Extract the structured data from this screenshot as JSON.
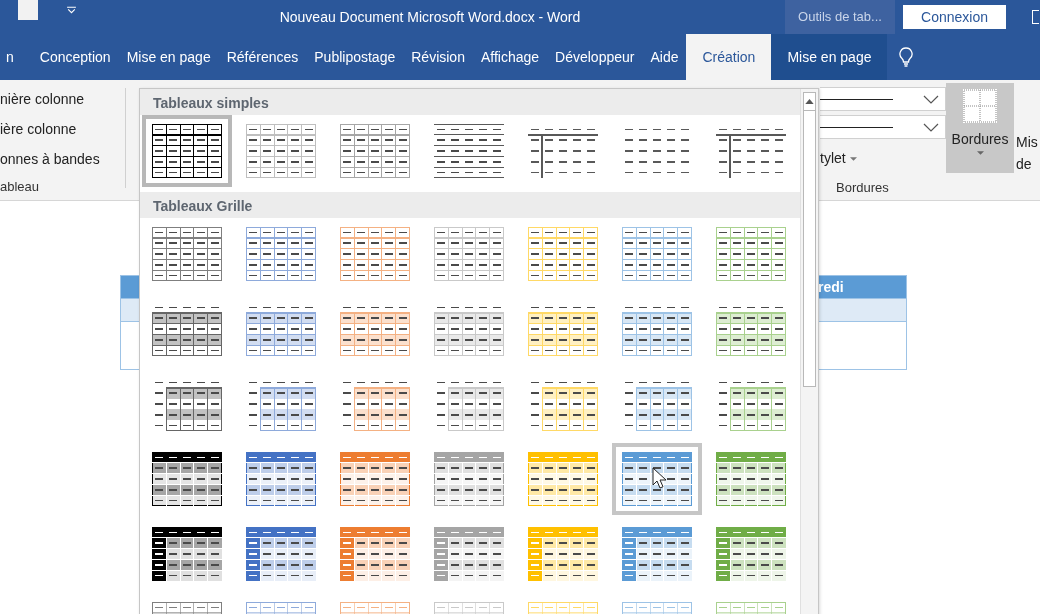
{
  "window": {
    "title": "Nouveau Document Microsoft Word.docx - Word",
    "context_label": "Outils de tab...",
    "signin": "Connexion"
  },
  "tabs": [
    {
      "label": "n",
      "selected": false,
      "kind": "standard"
    },
    {
      "label": "Conception",
      "selected": false,
      "kind": "standard"
    },
    {
      "label": "Mise en page",
      "selected": false,
      "kind": "standard"
    },
    {
      "label": "Références",
      "selected": false,
      "kind": "standard"
    },
    {
      "label": "Publipostage",
      "selected": false,
      "kind": "standard"
    },
    {
      "label": "Révision",
      "selected": false,
      "kind": "standard"
    },
    {
      "label": "Affichage",
      "selected": false,
      "kind": "standard"
    },
    {
      "label": "Développeur",
      "selected": false,
      "kind": "standard"
    },
    {
      "label": "Aide",
      "selected": false,
      "kind": "standard"
    },
    {
      "label": "Création",
      "selected": true,
      "kind": "contextual"
    },
    {
      "label": "Mise en page",
      "selected": false,
      "kind": "contextual"
    }
  ],
  "ribbon": {
    "options": [
      "nière colonne",
      "ière colonne",
      "onnes à bandes"
    ],
    "options_group": "ableau",
    "pen_style": "tylet",
    "borders_group": "Bordures",
    "borders_button": "Bordures",
    "next_button": [
      "Mis",
      "de"
    ]
  },
  "document": {
    "table_header": "redi"
  },
  "gallery": {
    "sections": [
      {
        "title": "Tableaux simples",
        "rows": [
          [
            {
              "kind": "grid",
              "color": "#000000",
              "selected": true,
              "hovered": false
            },
            {
              "kind": "grid",
              "color": "#bfbfbf",
              "selected": false,
              "hovered": false
            },
            {
              "kind": "grid",
              "color": "#a6a6a6",
              "selected": false,
              "hovered": false
            },
            {
              "kind": "lines",
              "color": "#595959",
              "selected": false,
              "hovered": false
            },
            {
              "kind": "first-col",
              "color": "#595959",
              "selected": false,
              "hovered": false
            },
            {
              "kind": "plain",
              "color": "#595959",
              "selected": false,
              "hovered": false
            },
            {
              "kind": "first-col",
              "color": "#595959",
              "selected": false,
              "hovered": false
            }
          ]
        ]
      },
      {
        "title": "Tableaux Grille",
        "rows": [
          [
            {
              "kind": "grid",
              "color": "#7f7f7f",
              "selected": false,
              "hovered": false
            },
            {
              "kind": "grid",
              "color": "#8eaadb",
              "selected": false,
              "hovered": false
            },
            {
              "kind": "grid",
              "color": "#f4b183",
              "selected": false,
              "hovered": false
            },
            {
              "kind": "grid",
              "color": "#c9c9c9",
              "selected": false,
              "hovered": false
            },
            {
              "kind": "grid",
              "color": "#ffd966",
              "selected": false,
              "hovered": false
            },
            {
              "kind": "grid",
              "color": "#9dc3e6",
              "selected": false,
              "hovered": false
            },
            {
              "kind": "grid",
              "color": "#a9d18e",
              "selected": false,
              "hovered": false
            }
          ],
          [
            {
              "kind": "banded",
              "color": "#666666",
              "selected": false,
              "hovered": false
            },
            {
              "kind": "banded",
              "color": "#8eaadb",
              "selected": false,
              "hovered": false
            },
            {
              "kind": "banded",
              "color": "#f4b183",
              "selected": false,
              "hovered": false
            },
            {
              "kind": "banded",
              "color": "#c9c9c9",
              "selected": false,
              "hovered": false
            },
            {
              "kind": "banded",
              "color": "#ffd966",
              "selected": false,
              "hovered": false
            },
            {
              "kind": "banded",
              "color": "#9dc3e6",
              "selected": false,
              "hovered": false
            },
            {
              "kind": "banded",
              "color": "#a9d18e",
              "selected": false,
              "hovered": false
            }
          ],
          [
            {
              "kind": "header-first-col",
              "color": "#666666",
              "selected": false,
              "hovered": false
            },
            {
              "kind": "header-first-col",
              "color": "#8eaadb",
              "selected": false,
              "hovered": false
            },
            {
              "kind": "header-first-col",
              "color": "#f4b183",
              "selected": false,
              "hovered": false
            },
            {
              "kind": "header-first-col",
              "color": "#c9c9c9",
              "selected": false,
              "hovered": false
            },
            {
              "kind": "header-first-col",
              "color": "#ffd966",
              "selected": false,
              "hovered": false
            },
            {
              "kind": "header-first-col",
              "color": "#9dc3e6",
              "selected": false,
              "hovered": false
            },
            {
              "kind": "header-first-col",
              "color": "#a9d18e",
              "selected": false,
              "hovered": false
            }
          ],
          [
            {
              "kind": "header-filled",
              "color": "#000000",
              "selected": false,
              "hovered": false
            },
            {
              "kind": "header-filled",
              "color": "#4472c4",
              "selected": false,
              "hovered": false
            },
            {
              "kind": "header-filled",
              "color": "#ed7d31",
              "selected": false,
              "hovered": false
            },
            {
              "kind": "header-filled",
              "color": "#a5a5a5",
              "selected": false,
              "hovered": false
            },
            {
              "kind": "header-filled",
              "color": "#ffc000",
              "selected": false,
              "hovered": false
            },
            {
              "kind": "header-filled",
              "color": "#5b9bd5",
              "selected": false,
              "hovered": true
            },
            {
              "kind": "header-filled",
              "color": "#70ad47",
              "selected": false,
              "hovered": false
            }
          ],
          [
            {
              "kind": "header-col-filled",
              "color": "#000000",
              "selected": false,
              "hovered": false
            },
            {
              "kind": "header-col-filled",
              "color": "#4472c4",
              "selected": false,
              "hovered": false
            },
            {
              "kind": "header-col-filled",
              "color": "#ed7d31",
              "selected": false,
              "hovered": false
            },
            {
              "kind": "header-col-filled",
              "color": "#a5a5a5",
              "selected": false,
              "hovered": false
            },
            {
              "kind": "header-col-filled",
              "color": "#ffc000",
              "selected": false,
              "hovered": false
            },
            {
              "kind": "header-col-filled",
              "color": "#5b9bd5",
              "selected": false,
              "hovered": false
            },
            {
              "kind": "header-col-filled",
              "color": "#70ad47",
              "selected": false,
              "hovered": false
            }
          ],
          [
            {
              "kind": "light-header",
              "color": "#7f7f7f",
              "selected": false,
              "hovered": false
            },
            {
              "kind": "light-header",
              "color": "#8eaadb",
              "selected": false,
              "hovered": false
            },
            {
              "kind": "light-header",
              "color": "#f4b183",
              "selected": false,
              "hovered": false
            },
            {
              "kind": "light-header",
              "color": "#c9c9c9",
              "selected": false,
              "hovered": false
            },
            {
              "kind": "light-header",
              "color": "#ffd966",
              "selected": false,
              "hovered": false
            },
            {
              "kind": "light-header",
              "color": "#9dc3e6",
              "selected": false,
              "hovered": false
            },
            {
              "kind": "light-header",
              "color": "#a9d18e",
              "selected": false,
              "hovered": false
            }
          ]
        ]
      }
    ]
  }
}
